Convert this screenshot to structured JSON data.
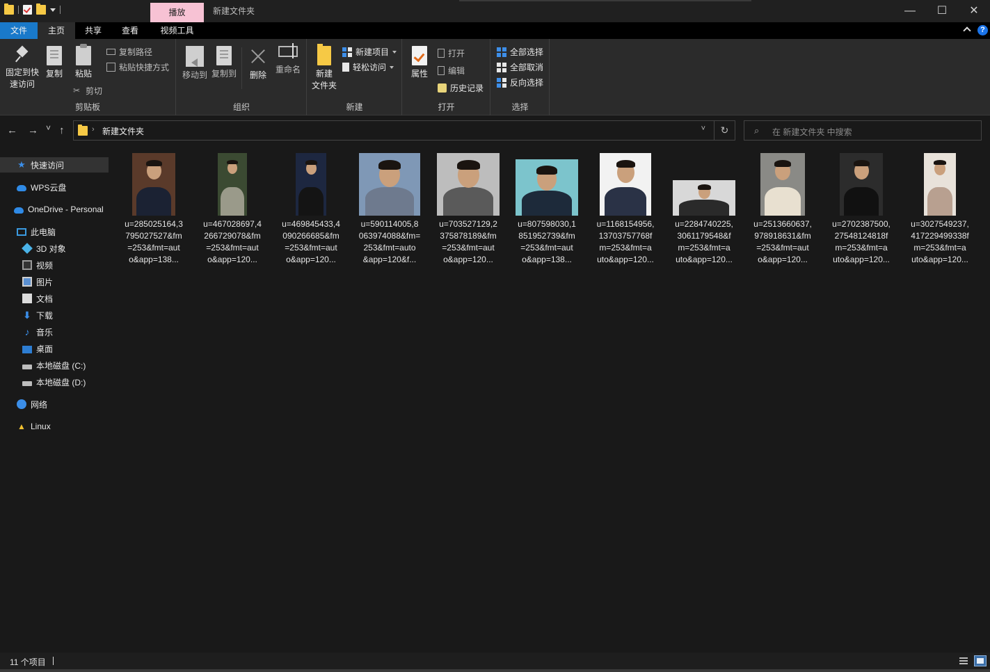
{
  "window": {
    "title": "新建文件夹",
    "context_tab": "播放",
    "minimize_glyph": "—",
    "maximize_glyph": "☐",
    "close_glyph": "✕"
  },
  "menu_tabs": {
    "file": "文件",
    "home": "主页",
    "share": "共享",
    "view": "查看",
    "video_tools": "视频工具",
    "help": "?"
  },
  "ribbon": {
    "clipboard": {
      "label": "剪贴板",
      "pin_line1": "固定到快",
      "pin_line2": "速访问",
      "copy": "复制",
      "paste": "粘贴",
      "copy_path": "复制路径",
      "paste_shortcut": "粘贴快捷方式",
      "cut": "剪切"
    },
    "organize": {
      "label": "组织",
      "move_to": "移动到",
      "copy_to": "复制到",
      "delete": "删除",
      "rename": "重命名"
    },
    "new": {
      "label": "新建",
      "new_folder_line1": "新建",
      "new_folder_line2": "文件夹",
      "new_item": "新建项目",
      "easy_access": "轻松访问"
    },
    "open": {
      "label": "打开",
      "properties": "属性",
      "open": "打开",
      "edit": "编辑",
      "history": "历史记录"
    },
    "select": {
      "label": "选择",
      "select_all": "全部选择",
      "select_none": "全部取消",
      "invert": "反向选择"
    }
  },
  "address": {
    "back": "←",
    "forward": "→",
    "recent": "˅",
    "up": "↑",
    "separator": "›",
    "path": "新建文件夹",
    "dropdown": "˅",
    "refresh": "↻"
  },
  "search": {
    "icon": "⌕",
    "placeholder": "在 新建文件夹 中搜索"
  },
  "sidebar": {
    "items": [
      {
        "label": "快速访问",
        "icon": "star-icon"
      },
      {
        "label": "WPS云盘",
        "icon": "cloud-icon"
      },
      {
        "label": "OneDrive - Personal",
        "icon": "cloud-icon"
      },
      {
        "label": "此电脑",
        "icon": "computer-icon"
      },
      {
        "label": "3D 对象",
        "icon": "cube-icon"
      },
      {
        "label": "视频",
        "icon": "video-icon"
      },
      {
        "label": "图片",
        "icon": "picture-icon"
      },
      {
        "label": "文档",
        "icon": "document-icon"
      },
      {
        "label": "下载",
        "icon": "download-icon"
      },
      {
        "label": "音乐",
        "icon": "music-icon"
      },
      {
        "label": "桌面",
        "icon": "desktop-icon"
      },
      {
        "label": "本地磁盘 (C:)",
        "icon": "drive-icon"
      },
      {
        "label": "本地磁盘 (D:)",
        "icon": "drive-icon"
      },
      {
        "label": "网络",
        "icon": "network-icon"
      },
      {
        "label": "Linux",
        "icon": "linux-icon"
      }
    ]
  },
  "files": [
    {
      "line1": "u=285025164,3",
      "line2": "795027527&fm",
      "line3": "=253&fmt=aut",
      "line4": "o&app=138...",
      "bg": "#5a3a2a",
      "suit": "#1b2233"
    },
    {
      "line1": "u=467028697,4",
      "line2": "266729078&fm",
      "line3": "=253&fmt=aut",
      "line4": "o&app=120...",
      "bg": "#3b4a32",
      "suit": "#9a9a8a"
    },
    {
      "line1": "u=469845433,4",
      "line2": "090266685&fm",
      "line3": "=253&fmt=aut",
      "line4": "o&app=120...",
      "bg": "#1d2740",
      "suit": "#141414"
    },
    {
      "line1": "u=590114005,8",
      "line2": "063974088&fm=",
      "line3": "253&fmt=auto",
      "line4": "&app=120&f...",
      "bg": "#7f98b6",
      "suit": "#6e7a8e"
    },
    {
      "line1": "u=703527129,2",
      "line2": "375878189&fm",
      "line3": "=253&fmt=aut",
      "line4": "o&app=120...",
      "bg": "#bdbdbd",
      "suit": "#5a5a5a"
    },
    {
      "line1": "u=807598030,1",
      "line2": "851952739&fm",
      "line3": "=253&fmt=aut",
      "line4": "o&app=138...",
      "bg": "#7cc4cc",
      "suit": "#1d2a3a"
    },
    {
      "line1": "u=1168154956,",
      "line2": "13703757768f",
      "line3": "m=253&fmt=a",
      "line4": "uto&app=120...",
      "bg": "#f2f2f2",
      "suit": "#2a3246"
    },
    {
      "line1": "u=2284740225,",
      "line2": "3061179548&f",
      "line3": "m=253&fmt=a",
      "line4": "uto&app=120...",
      "bg": "#d8d8d8",
      "suit": "#2a2a2a"
    },
    {
      "line1": "u=2513660637,",
      "line2": "978918631&fm",
      "line3": "=253&fmt=aut",
      "line4": "o&app=120...",
      "bg": "#8a8a86",
      "suit": "#e8e0d0"
    },
    {
      "line1": "u=2702387500,",
      "line2": "27548124818f",
      "line3": "m=253&fmt=a",
      "line4": "uto&app=120...",
      "bg": "#2c2c2c",
      "suit": "#111111"
    },
    {
      "line1": "u=3027549237,",
      "line2": "417229499338f",
      "line3": "m=253&fmt=a",
      "line4": "uto&app=120...",
      "bg": "#e8e2da",
      "suit": "#b8a090"
    }
  ],
  "status": {
    "count": "11 个项目"
  },
  "colors": {
    "accent": "#1979ca",
    "context_tab": "#f7c2d4",
    "folder": "#f6c945",
    "background": "#191919"
  }
}
